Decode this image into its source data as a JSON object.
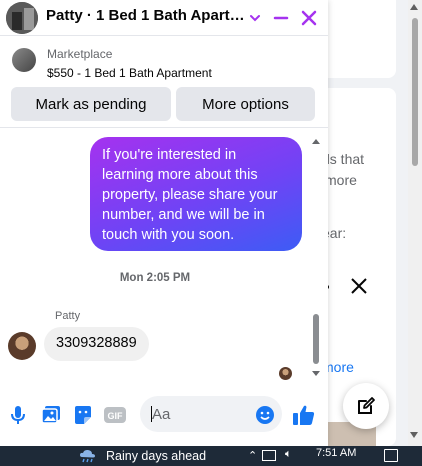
{
  "header": {
    "title": "Patty · 1 Bed 1 Bath Apart…"
  },
  "marketplace": {
    "label": "Marketplace",
    "item": "$550 - 1 Bed 1 Bath Apartment",
    "mark_pending_label": "Mark as pending",
    "more_options_label": "More options"
  },
  "messages": {
    "outgoing_text": "If you're interested in learning more about this property, please share your number, and we will be in touch with you soon.",
    "timestamp": "Mon 2:05 PM",
    "sender_name": "Patty",
    "incoming_text": "3309328889"
  },
  "composer": {
    "placeholder": "Aa"
  },
  "background": {
    "text_1": "ds that",
    "text_2": "more",
    "text_3": "ear:",
    "link_more": "more"
  },
  "taskbar": {
    "weather": "Rainy days ahead",
    "time": "7:51 AM"
  },
  "colors": {
    "accent": "#a532ef",
    "bubble_gradient_end": "#3d5cf5",
    "brand_blue": "#1877f2"
  }
}
